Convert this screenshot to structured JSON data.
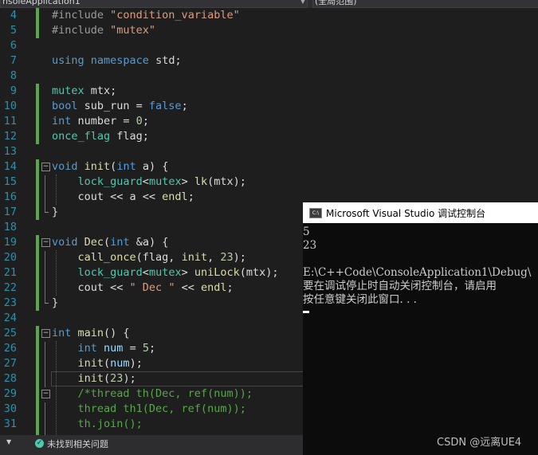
{
  "top_bar": {
    "scope_left": "nsoleApplication1",
    "scope_right": "(全局范围)"
  },
  "editor": {
    "lines": [
      {
        "n": "4",
        "tokens": [
          {
            "t": "#include ",
            "c": "inc"
          },
          {
            "t": "\"condition_variable\"",
            "c": "str"
          }
        ]
      },
      {
        "n": "5",
        "tokens": [
          {
            "t": "#include ",
            "c": "inc"
          },
          {
            "t": "\"mutex\"",
            "c": "str"
          }
        ]
      },
      {
        "n": "6",
        "tokens": []
      },
      {
        "n": "7",
        "tokens": [
          {
            "t": "using",
            "c": "kw"
          },
          {
            "t": " ",
            "c": ""
          },
          {
            "t": "namespace",
            "c": "kw"
          },
          {
            "t": " std;",
            "c": ""
          }
        ]
      },
      {
        "n": "8",
        "tokens": []
      },
      {
        "n": "9",
        "tokens": [
          {
            "t": "mutex",
            "c": "ty"
          },
          {
            "t": " mtx;",
            "c": ""
          }
        ]
      },
      {
        "n": "10",
        "tokens": [
          {
            "t": "bool",
            "c": "kw"
          },
          {
            "t": " sub_run = ",
            "c": ""
          },
          {
            "t": "false",
            "c": "kw"
          },
          {
            "t": ";",
            "c": ""
          }
        ]
      },
      {
        "n": "11",
        "tokens": [
          {
            "t": "int",
            "c": "kw"
          },
          {
            "t": " number = ",
            "c": ""
          },
          {
            "t": "0",
            "c": "num"
          },
          {
            "t": ";",
            "c": ""
          }
        ]
      },
      {
        "n": "12",
        "tokens": [
          {
            "t": "once_flag",
            "c": "ty"
          },
          {
            "t": " flag;",
            "c": ""
          }
        ]
      },
      {
        "n": "13",
        "tokens": []
      },
      {
        "n": "14",
        "tokens": [
          {
            "t": "void",
            "c": "kw"
          },
          {
            "t": " ",
            "c": ""
          },
          {
            "t": "init",
            "c": "fn"
          },
          {
            "t": "(",
            "c": ""
          },
          {
            "t": "int",
            "c": "kw"
          },
          {
            "t": " a) {",
            "c": ""
          }
        ]
      },
      {
        "n": "15",
        "tokens": [
          {
            "t": "    ",
            "c": ""
          },
          {
            "t": "lock_guard",
            "c": "ty"
          },
          {
            "t": "<",
            "c": ""
          },
          {
            "t": "mutex",
            "c": "ty"
          },
          {
            "t": "> ",
            "c": ""
          },
          {
            "t": "lk",
            "c": "fn"
          },
          {
            "t": "(mtx);",
            "c": ""
          }
        ]
      },
      {
        "n": "16",
        "tokens": [
          {
            "t": "    cout << a << ",
            "c": ""
          },
          {
            "t": "endl",
            "c": "fn"
          },
          {
            "t": ";",
            "c": ""
          }
        ]
      },
      {
        "n": "17",
        "tokens": [
          {
            "t": "}",
            "c": ""
          }
        ]
      },
      {
        "n": "18",
        "tokens": []
      },
      {
        "n": "19",
        "tokens": [
          {
            "t": "void",
            "c": "kw"
          },
          {
            "t": " ",
            "c": ""
          },
          {
            "t": "Dec",
            "c": "fn"
          },
          {
            "t": "(",
            "c": ""
          },
          {
            "t": "int",
            "c": "kw"
          },
          {
            "t": " &a) {",
            "c": ""
          }
        ]
      },
      {
        "n": "20",
        "tokens": [
          {
            "t": "    ",
            "c": ""
          },
          {
            "t": "call_once",
            "c": "fn"
          },
          {
            "t": "(flag, ",
            "c": ""
          },
          {
            "t": "init",
            "c": "fn"
          },
          {
            "t": ", ",
            "c": ""
          },
          {
            "t": "23",
            "c": "num"
          },
          {
            "t": ");",
            "c": ""
          }
        ]
      },
      {
        "n": "21",
        "tokens": [
          {
            "t": "    ",
            "c": ""
          },
          {
            "t": "lock_guard",
            "c": "ty"
          },
          {
            "t": "<",
            "c": ""
          },
          {
            "t": "mutex",
            "c": "ty"
          },
          {
            "t": "> ",
            "c": ""
          },
          {
            "t": "uniLock",
            "c": "fn"
          },
          {
            "t": "(mtx);",
            "c": ""
          }
        ]
      },
      {
        "n": "22",
        "tokens": [
          {
            "t": "    cout << ",
            "c": ""
          },
          {
            "t": "\" Dec \"",
            "c": "str"
          },
          {
            "t": " << ",
            "c": ""
          },
          {
            "t": "endl",
            "c": "fn"
          },
          {
            "t": ";",
            "c": ""
          }
        ]
      },
      {
        "n": "23",
        "tokens": [
          {
            "t": "}",
            "c": ""
          }
        ]
      },
      {
        "n": "24",
        "tokens": []
      },
      {
        "n": "25",
        "tokens": [
          {
            "t": "int",
            "c": "kw"
          },
          {
            "t": " ",
            "c": ""
          },
          {
            "t": "main",
            "c": "fn"
          },
          {
            "t": "() {",
            "c": ""
          }
        ]
      },
      {
        "n": "26",
        "tokens": [
          {
            "t": "    ",
            "c": ""
          },
          {
            "t": "int",
            "c": "kw"
          },
          {
            "t": " ",
            "c": ""
          },
          {
            "t": "num",
            "c": "var"
          },
          {
            "t": " = ",
            "c": ""
          },
          {
            "t": "5",
            "c": "num"
          },
          {
            "t": ";",
            "c": ""
          }
        ]
      },
      {
        "n": "27",
        "tokens": [
          {
            "t": "    ",
            "c": ""
          },
          {
            "t": "init",
            "c": "fn"
          },
          {
            "t": "(",
            "c": ""
          },
          {
            "t": "num",
            "c": "var"
          },
          {
            "t": ");",
            "c": ""
          }
        ]
      },
      {
        "n": "28",
        "tokens": [
          {
            "t": "    ",
            "c": ""
          },
          {
            "t": "init",
            "c": "fn"
          },
          {
            "t": "(",
            "c": ""
          },
          {
            "t": "23",
            "c": "num"
          },
          {
            "t": ");",
            "c": ""
          }
        ]
      },
      {
        "n": "29",
        "tokens": [
          {
            "t": "    /*thread th(Dec, ref(num));",
            "c": "cm"
          }
        ]
      },
      {
        "n": "30",
        "tokens": [
          {
            "t": "    thread th1(Dec, ref(num));",
            "c": "cm"
          }
        ]
      },
      {
        "n": "31",
        "tokens": [
          {
            "t": "    th.join();",
            "c": "cm"
          }
        ]
      }
    ],
    "fold_lines": [
      "14",
      "19",
      "25",
      "29"
    ]
  },
  "status_bar": {
    "message": "未找到相关问题"
  },
  "console": {
    "title": "Microsoft Visual Studio 调试控制台",
    "icon_label": "C:\\",
    "output_lines": [
      "5",
      "23",
      "",
      "E:\\C++Code\\ConsoleApplication1\\Debug\\",
      "要在调试停止时自动关闭控制台，请启用",
      "按任意键关闭此窗口. . ."
    ]
  },
  "watermark": "CSDN @远离UE4",
  "colors": {
    "keyword": "#569cd6",
    "type": "#4ec9b0",
    "function": "#dcdcaa",
    "string": "#d69d85",
    "number": "#b5cea8",
    "comment": "#57a64a",
    "line_number": "#2b91af",
    "change_bar": "#57a64a"
  }
}
